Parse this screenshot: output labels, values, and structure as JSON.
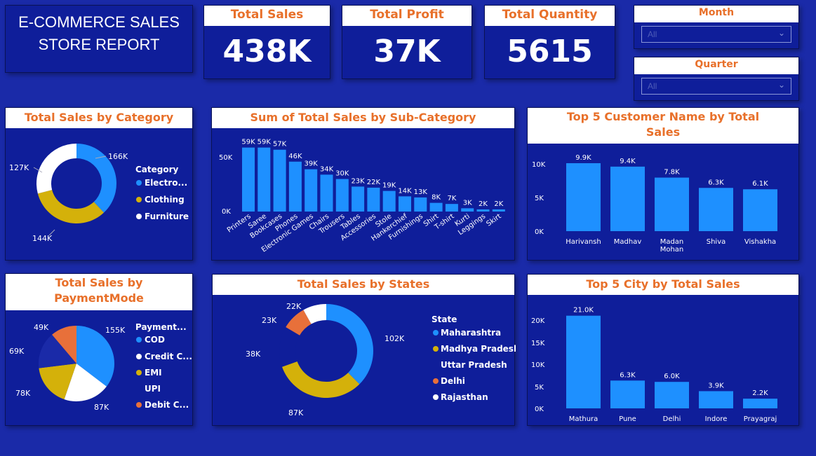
{
  "title": {
    "line1": "E-COMMERCE SALES",
    "line2": "STORE REPORT"
  },
  "kpis": [
    {
      "label": "Total Sales",
      "value": "438K"
    },
    {
      "label": "Total Profit",
      "value": "37K"
    },
    {
      "label": "Total Quantity",
      "value": "5615"
    }
  ],
  "slicers": {
    "month": {
      "label": "Month",
      "value": "All"
    },
    "quarter": {
      "label": "Quarter",
      "value": "All"
    }
  },
  "colors": {
    "blue": "#1e90ff",
    "gold": "#d4b10a",
    "white": "#ffffff",
    "orange": "#e8703a",
    "header_text": "#e8702a",
    "bg": "#1a2aa8",
    "card": "#0f1e9a"
  },
  "charts": {
    "category": {
      "title": "Total Sales by Category",
      "legend_title": "Category",
      "labels": [
        "166K",
        "144K",
        "127K"
      ],
      "legend": [
        "Electro...",
        "Clothing",
        "Furniture"
      ]
    },
    "subcategory": {
      "title": "Sum of Total Sales by Sub-Category",
      "ticks": [
        "50K",
        "0K"
      ]
    },
    "customers": {
      "title_line1": "Top 5 Customer Name by Total",
      "title_line2": "Sales",
      "ticks": [
        "10K",
        "5K",
        "0K"
      ]
    },
    "payment": {
      "title_line1": "Total Sales by",
      "title_line2": "PaymentMode",
      "legend_title": "Payment...",
      "labels": [
        "155K",
        "87K",
        "78K",
        "69K",
        "49K"
      ],
      "legend": [
        "COD",
        "Credit C...",
        "EMI",
        "UPI",
        "Debit C..."
      ]
    },
    "states": {
      "title": "Total Sales by States",
      "legend_title": "State",
      "labels": [
        "102K",
        "87K",
        "38K",
        "23K",
        "22K"
      ],
      "legend": [
        "Maharashtra",
        "Madhya Pradesh",
        "Uttar Pradesh",
        "Delhi",
        "Rajasthan"
      ]
    },
    "cities": {
      "title": "Top 5 City by Total Sales",
      "ticks": [
        "20K",
        "15K",
        "10K",
        "5K",
        "0K"
      ]
    }
  },
  "chart_data": [
    {
      "type": "pie",
      "title": "Total Sales by Category",
      "categories": [
        "Electronics",
        "Clothing",
        "Furniture"
      ],
      "values": [
        166,
        144,
        127
      ],
      "unit": "K"
    },
    {
      "type": "bar",
      "title": "Sum of Total Sales by Sub-Category",
      "categories": [
        "Printers",
        "Saree",
        "Bookcases",
        "Phones",
        "Electronic Games",
        "Chairs",
        "Trousers",
        "Tables",
        "Accessories",
        "Stole",
        "Hankerchief",
        "Furnishings",
        "Shirt",
        "T-shirt",
        "Kurti",
        "Leggings",
        "Skirt"
      ],
      "values": [
        59,
        59,
        57,
        46,
        39,
        34,
        30,
        23,
        22,
        19,
        14,
        13,
        8,
        7,
        3,
        2,
        2
      ],
      "value_labels": [
        "59K",
        "59K",
        "57K",
        "46K",
        "39K",
        "34K",
        "30K",
        "23K",
        "22K",
        "19K",
        "14K",
        "13K",
        "8K",
        "7K",
        "3K",
        "2K",
        "2K"
      ],
      "ylim": [
        0,
        62
      ]
    },
    {
      "type": "bar",
      "title": "Top 5 Customer Name by Total Sales",
      "categories": [
        "Harivansh",
        "Madhav",
        "Madan Mohan",
        "Shiva",
        "Vishakha"
      ],
      "values": [
        9.9,
        9.4,
        7.8,
        6.3,
        6.1
      ],
      "value_labels": [
        "9.9K",
        "9.4K",
        "7.8K",
        "6.3K",
        "6.1K"
      ],
      "ylim": [
        0,
        10
      ]
    },
    {
      "type": "pie",
      "title": "Total Sales by PaymentMode",
      "categories": [
        "COD",
        "Credit Card",
        "EMI",
        "UPI",
        "Debit Card"
      ],
      "values": [
        155,
        87,
        78,
        69,
        49
      ],
      "unit": "K"
    },
    {
      "type": "pie",
      "title": "Total Sales by States",
      "categories": [
        "Maharashtra",
        "Madhya Pradesh",
        "Uttar Pradesh",
        "Delhi",
        "Rajasthan"
      ],
      "values": [
        102,
        87,
        38,
        23,
        22
      ],
      "unit": "K"
    },
    {
      "type": "bar",
      "title": "Top 5 City by Total Sales",
      "categories": [
        "Mathura",
        "Pune",
        "Delhi",
        "Indore",
        "Prayagraj"
      ],
      "values": [
        21.0,
        6.3,
        6.0,
        3.9,
        2.2
      ],
      "value_labels": [
        "21.0K",
        "6.3K",
        "6.0K",
        "3.9K",
        "2.2K"
      ],
      "ylim": [
        0,
        20
      ]
    }
  ]
}
